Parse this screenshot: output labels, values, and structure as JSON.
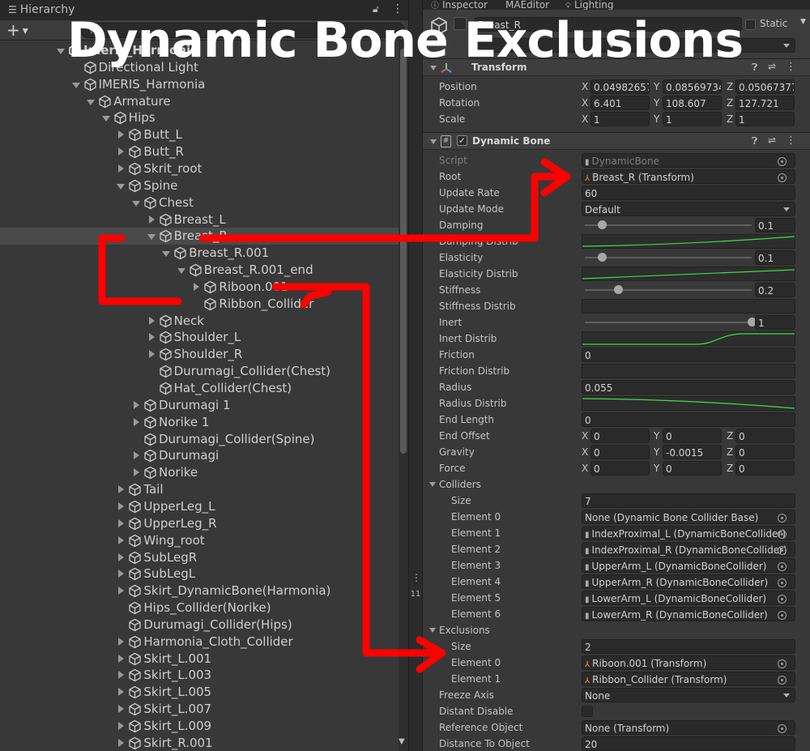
{
  "overlay_title": "Dynamic Bone Exclusions",
  "hierarchy": {
    "tab_label": "Hierarchy",
    "add_label": "+",
    "rows": [
      {
        "label": "Imeris_Harmonia",
        "indent": 0,
        "arrow": "d",
        "icon": "unity",
        "obscured": true
      },
      {
        "label": "Directional Light",
        "indent": 1,
        "arrow": "",
        "icon": "cube"
      },
      {
        "label": "IMERIS_Harmonia",
        "indent": 1,
        "arrow": "d",
        "icon": "cube"
      },
      {
        "label": "Armature",
        "indent": 2,
        "arrow": "d",
        "icon": "cube"
      },
      {
        "label": "Hips",
        "indent": 3,
        "arrow": "d",
        "icon": "cube"
      },
      {
        "label": "Butt_L",
        "indent": 4,
        "arrow": "r",
        "icon": "cube"
      },
      {
        "label": "Butt_R",
        "indent": 4,
        "arrow": "r",
        "icon": "cube"
      },
      {
        "label": "Skrit_root",
        "indent": 4,
        "arrow": "r",
        "icon": "cube"
      },
      {
        "label": "Spine",
        "indent": 4,
        "arrow": "d",
        "icon": "cube"
      },
      {
        "label": "Chest",
        "indent": 5,
        "arrow": "d",
        "icon": "cube"
      },
      {
        "label": "Breast_L",
        "indent": 6,
        "arrow": "r",
        "icon": "cube"
      },
      {
        "label": "Breast_R",
        "indent": 6,
        "arrow": "d",
        "icon": "cube",
        "selected": true
      },
      {
        "label": "Breast_R.001",
        "indent": 7,
        "arrow": "d",
        "icon": "cube"
      },
      {
        "label": "Breast_R.001_end",
        "indent": 8,
        "arrow": "d",
        "icon": "cube"
      },
      {
        "label": "Riboon.001",
        "indent": 9,
        "arrow": "r",
        "icon": "cube"
      },
      {
        "label": "Ribbon_Collider",
        "indent": 9,
        "arrow": "",
        "icon": "cube"
      },
      {
        "label": "Neck",
        "indent": 6,
        "arrow": "r",
        "icon": "cube"
      },
      {
        "label": "Shoulder_L",
        "indent": 6,
        "arrow": "r",
        "icon": "cube"
      },
      {
        "label": "Shoulder_R",
        "indent": 6,
        "arrow": "r",
        "icon": "cube"
      },
      {
        "label": "Durumagi_Collider(Chest)",
        "indent": 6,
        "arrow": "",
        "icon": "cube"
      },
      {
        "label": "Hat_Collider(Chest)",
        "indent": 6,
        "arrow": "",
        "icon": "cube"
      },
      {
        "label": "Durumagi 1",
        "indent": 5,
        "arrow": "r",
        "icon": "cube"
      },
      {
        "label": "Norike 1",
        "indent": 5,
        "arrow": "r",
        "icon": "cube"
      },
      {
        "label": "Durumagi_Collider(Spine)",
        "indent": 5,
        "arrow": "",
        "icon": "cube"
      },
      {
        "label": "Durumagi",
        "indent": 5,
        "arrow": "r",
        "icon": "cube"
      },
      {
        "label": "Norike",
        "indent": 5,
        "arrow": "r",
        "icon": "cube"
      },
      {
        "label": "Tail",
        "indent": 4,
        "arrow": "r",
        "icon": "cube"
      },
      {
        "label": "UpperLeg_L",
        "indent": 4,
        "arrow": "r",
        "icon": "cube"
      },
      {
        "label": "UpperLeg_R",
        "indent": 4,
        "arrow": "r",
        "icon": "cube"
      },
      {
        "label": "Wing_root",
        "indent": 4,
        "arrow": "r",
        "icon": "cube"
      },
      {
        "label": "SubLegR",
        "indent": 4,
        "arrow": "r",
        "icon": "cube"
      },
      {
        "label": "SubLegL",
        "indent": 4,
        "arrow": "r",
        "icon": "cube"
      },
      {
        "label": "Skirt_DynamicBone(Harmonia)",
        "indent": 4,
        "arrow": "r",
        "icon": "cube"
      },
      {
        "label": "Hips_Collider(Norike)",
        "indent": 4,
        "arrow": "",
        "icon": "cube"
      },
      {
        "label": "Durumagi_Collider(Hips)",
        "indent": 4,
        "arrow": "",
        "icon": "cube"
      },
      {
        "label": "Harmonia_Cloth_Collider",
        "indent": 4,
        "arrow": "r",
        "icon": "cube"
      },
      {
        "label": "Skirt_L.001",
        "indent": 4,
        "arrow": "r",
        "icon": "cube"
      },
      {
        "label": "Skirt_L.003",
        "indent": 4,
        "arrow": "r",
        "icon": "cube"
      },
      {
        "label": "Skirt_L.005",
        "indent": 4,
        "arrow": "r",
        "icon": "cube"
      },
      {
        "label": "Skirt_L.007",
        "indent": 4,
        "arrow": "r",
        "icon": "cube"
      },
      {
        "label": "Skirt_L.009",
        "indent": 4,
        "arrow": "r",
        "icon": "cube"
      },
      {
        "label": "Skirt_R.001",
        "indent": 4,
        "arrow": "r",
        "icon": "cube"
      }
    ]
  },
  "divider_label": "11",
  "inspector": {
    "tabs": [
      "Inspector",
      "MAEditor",
      "Lighting"
    ],
    "object_name": "Breast_R",
    "static_label": "Static",
    "transform": {
      "title": "Transform",
      "position": {
        "label": "Position",
        "x": "0.04982657",
        "y": "0.08569734",
        "z": "0.05067377"
      },
      "rotation": {
        "label": "Rotation",
        "x": "6.401",
        "y": "108.607",
        "z": "127.721"
      },
      "scale": {
        "label": "Scale",
        "x": "1",
        "y": "1",
        "z": "1"
      }
    },
    "dynamic_bone": {
      "title": "Dynamic Bone",
      "script": {
        "label": "Script",
        "value": "DynamicBone"
      },
      "root": {
        "label": "Root",
        "value": "Breast_R (Transform)"
      },
      "update_rate": {
        "label": "Update Rate",
        "value": "60"
      },
      "update_mode": {
        "label": "Update Mode",
        "value": "Default"
      },
      "damping": {
        "label": "Damping",
        "value": "0.1",
        "fraction": 0.1
      },
      "damping_distrib": {
        "label": "Damping Distrib"
      },
      "elasticity": {
        "label": "Elasticity",
        "value": "0.1",
        "fraction": 0.1
      },
      "elasticity_distrib": {
        "label": "Elasticity Distrib"
      },
      "stiffness": {
        "label": "Stiffness",
        "value": "0.2",
        "fraction": 0.2
      },
      "stiffness_distrib": {
        "label": "Stiffness Distrib"
      },
      "inert": {
        "label": "Inert",
        "value": "1",
        "fraction": 1
      },
      "inert_distrib": {
        "label": "Inert Distrib"
      },
      "friction": {
        "label": "Friction",
        "value": "0"
      },
      "friction_distrib": {
        "label": "Friction Distrib"
      },
      "radius": {
        "label": "Radius",
        "value": "0.055"
      },
      "radius_distrib": {
        "label": "Radius Distrib"
      },
      "end_length": {
        "label": "End Length",
        "value": "0"
      },
      "end_offset": {
        "label": "End Offset",
        "x": "0",
        "y": "0",
        "z": "0"
      },
      "gravity": {
        "label": "Gravity",
        "x": "0",
        "y": "-0.0015",
        "z": "0"
      },
      "force": {
        "label": "Force",
        "x": "0",
        "y": "0",
        "z": "0"
      },
      "colliders": {
        "label": "Colliders",
        "size_label": "Size",
        "size": "7",
        "elements": [
          {
            "label": "Element 0",
            "value": "None (Dynamic Bone Collider Base)"
          },
          {
            "label": "Element 1",
            "value": "IndexProximal_L (DynamicBoneCollider)"
          },
          {
            "label": "Element 2",
            "value": "IndexProximal_R (DynamicBoneCollider)"
          },
          {
            "label": "Element 3",
            "value": "UpperArm_L (DynamicBoneCollider)"
          },
          {
            "label": "Element 4",
            "value": "UpperArm_R (DynamicBoneCollider)"
          },
          {
            "label": "Element 5",
            "value": "LowerArm_L (DynamicBoneCollider)"
          },
          {
            "label": "Element 6",
            "value": "LowerArm_R (DynamicBoneCollider)"
          }
        ]
      },
      "exclusions": {
        "label": "Exclusions",
        "size_label": "Size",
        "size": "2",
        "elements": [
          {
            "label": "Element 0",
            "value": "Riboon.001 (Transform)"
          },
          {
            "label": "Element 1",
            "value": "Ribbon_Collider (Transform)"
          }
        ]
      },
      "freeze_axis": {
        "label": "Freeze Axis",
        "value": "None"
      },
      "distant_disable": {
        "label": "Distant Disable"
      },
      "reference_object": {
        "label": "Reference Object",
        "value": "None (Transform)"
      },
      "distance_to_object": {
        "label": "Distance To Object",
        "value": "20"
      }
    }
  },
  "colors": {
    "annotation": "#ff0000",
    "selection": "#4a4a4a",
    "curve": "#3fdc3f"
  }
}
